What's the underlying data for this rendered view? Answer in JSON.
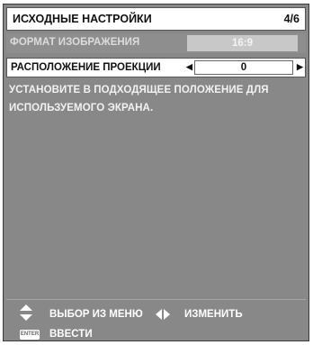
{
  "header": {
    "title": "ИСХОДНЫЕ НАСТРОЙКИ",
    "page": "4/6"
  },
  "rows": [
    {
      "label": "ФОРМАТ ИЗОБРАЖЕНИЯ",
      "value": "16:9"
    },
    {
      "label": "РАСПОЛОЖЕНИЕ ПРОЕКЦИИ",
      "value": "0"
    }
  ],
  "description": {
    "line1": "УСТАНОВИТЕ В ПОДХОДЯЩЕЕ ПОЛОЖЕНИЕ ДЛЯ",
    "line2": "ИСПОЛЬЗУЕМОГО ЭКРАНА."
  },
  "footer": {
    "select_label": "ВЫБОР ИЗ МЕНЮ",
    "change_label": "ИЗМЕНИТЬ",
    "enter_label": "ВВЕСТИ",
    "enter_icon_text": "ENTER"
  },
  "colors": {
    "frame_bg": "#888888",
    "text_light": "#f2f2f2",
    "highlight_row_bg": "#ffffff"
  }
}
